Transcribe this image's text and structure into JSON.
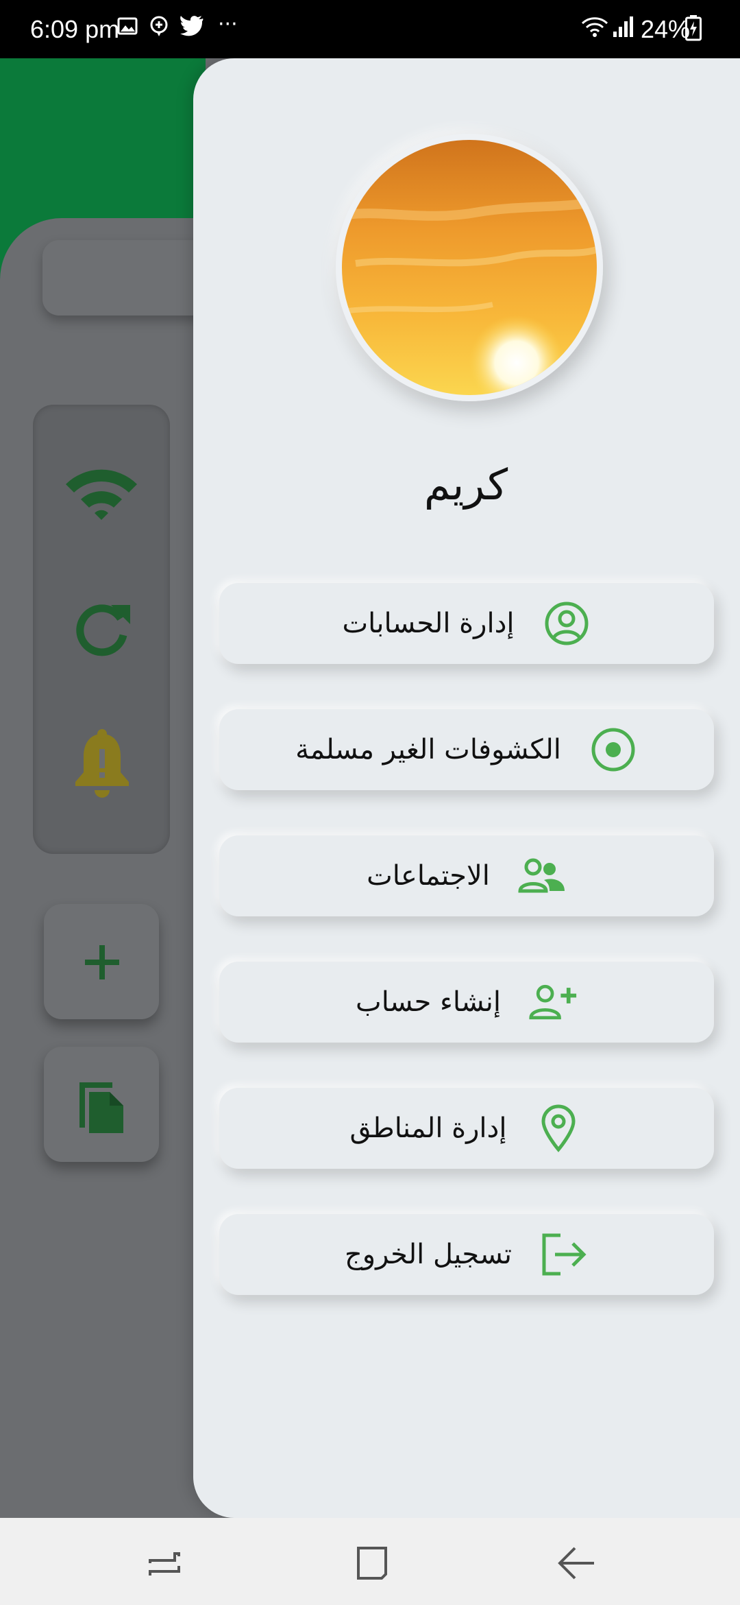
{
  "status_bar": {
    "time": "6:09 pm",
    "battery": "24%",
    "more": "···"
  },
  "drawer": {
    "user_name": "كريم",
    "menu": [
      {
        "label": "إدارة الحسابات",
        "icon": "account-circle-icon"
      },
      {
        "label": "الكشوفات الغير مسلمة",
        "icon": "radio-target-icon"
      },
      {
        "label": "الاجتماعات",
        "icon": "people-icon"
      },
      {
        "label": "إنشاء حساب",
        "icon": "person-add-icon"
      },
      {
        "label": "إدارة المناطق",
        "icon": "location-pin-icon"
      },
      {
        "label": "تسجيل الخروج",
        "icon": "logout-icon"
      }
    ]
  },
  "colors": {
    "accent_green": "#4caf50",
    "header_green": "#0b7a3a",
    "drawer_bg": "#e8ecef",
    "scrim": "#6b6d70"
  },
  "background_icons": [
    "wifi-icon",
    "refresh-icon",
    "bell-icon",
    "plus-icon",
    "document-icon"
  ],
  "nav_bar": {
    "icons": [
      "recents-icon",
      "home-icon",
      "back-icon"
    ]
  }
}
